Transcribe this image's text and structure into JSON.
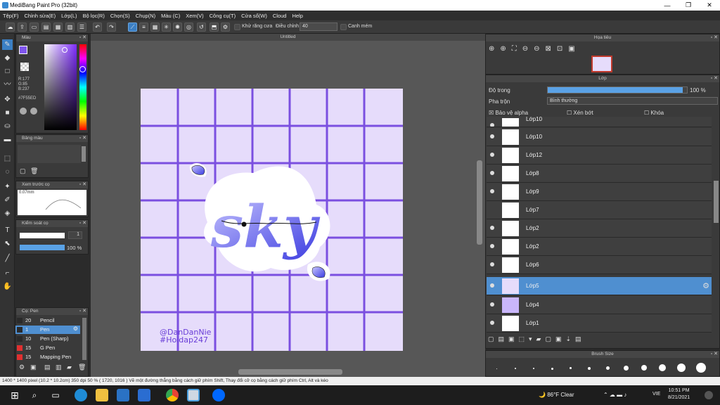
{
  "window": {
    "title": "MediBang Paint Pro (32bit)",
    "min": "—",
    "max": "❐",
    "close": "✕"
  },
  "menu": [
    "Tệp(F)",
    "Chỉnh sửa(E)",
    "Lớp(L)",
    "Bộ lọc(R)",
    "Chọn(S)",
    "Chụp(N)",
    "Màu (C)",
    "Xem(V)",
    "Công cụ(T)",
    "Cửa sổ(W)",
    "Cloud",
    "Help"
  ],
  "toolbar": {
    "antialias_label": "Khử răng cưa",
    "adjust_label": "Điều chỉnh",
    "adjust_value": "40",
    "snap_label": "Canh mém"
  },
  "color_panel": {
    "title": "Màu",
    "r": "R:177",
    "g": "G:85",
    "b": "B:237",
    "hex": "#7F55ED"
  },
  "color_bar_panel": {
    "title": "Bảng màu"
  },
  "brush_preview": {
    "title": "Xem trước cọ",
    "size": "0.07mm"
  },
  "brush_control": {
    "title": "Kiểm soát cọ",
    "size_value": "1",
    "opacity_value": "100 %"
  },
  "brush_list": {
    "title": "Cọ: Pen",
    "items": [
      {
        "num": "20",
        "name": "Pencil",
        "color": "#2a2a2a"
      },
      {
        "num": "1",
        "name": "Pen",
        "color": "#2a2a2a"
      },
      {
        "num": "10",
        "name": "Pen (Sharp)",
        "color": "#2a2a2a"
      },
      {
        "num": "15",
        "name": "G Pen",
        "color": "#e03030"
      },
      {
        "num": "15",
        "name": "Mapping Pen",
        "color": "#e03030"
      }
    ]
  },
  "canvas": {
    "tab_title": "Untitled",
    "watermark1": "@DanDanNie",
    "watermark2": "#Hoidap247",
    "lettering": "sky",
    "bg": "#e6dcfb",
    "grid": "#7b4fe0"
  },
  "navigator": {
    "title": "Họa tiêu"
  },
  "layer_panel": {
    "title": "Lớp",
    "opacity_label": "Độ trong",
    "opacity_value": "100 %",
    "blend_label": "Pha trộn",
    "blend_value": "Bình thường",
    "protect_alpha": "Bảo vệ alpha",
    "clip": "Xén bớt",
    "lock": "Khóa",
    "opacity_fraction": 0.97
  },
  "layers": [
    "Lớp10",
    "Lớp10",
    "Lớp12",
    "Lớp8",
    "Lớp9",
    "Lớp7",
    "Lớp2",
    "Lớp2",
    "Lớp6",
    "Lớp5",
    "Lớp4",
    "Lớp1"
  ],
  "brush_size": {
    "title": "Brush Size"
  },
  "status": "1400 * 1400 pixel  (10.2 * 10.2cm)  350 dpi   50 %  ( 1720, 1016 )   Vẽ một đường thẳng bằng cách giữ phím Shift, Thay đổi cỡ cọ bằng cách giữ phím Ctrl, Alt và kéo",
  "taskbar": {
    "weather": "86°F  Clear",
    "lang": "VIE",
    "time": "10:51 PM",
    "date": "8/21/2021"
  }
}
